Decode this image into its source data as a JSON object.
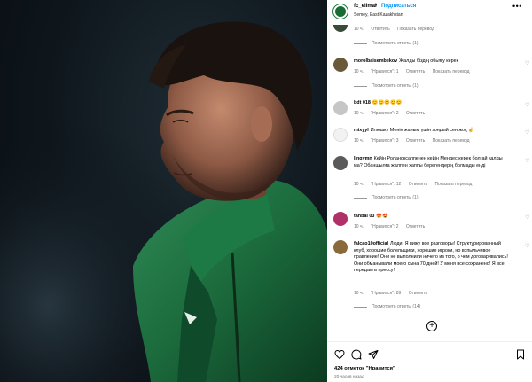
{
  "post": {
    "username": "fc_elimai",
    "separator": "•",
    "follow_label": "Подписаться",
    "location": "Semey, East Kazakhstan",
    "more_label": "•••"
  },
  "comments": [
    {
      "user": "",
      "text": "",
      "time": "10 ч.",
      "reply": "Ответить",
      "translate": "Показать перевод",
      "replies": "Посмотреть ответы (1)",
      "avatar_color": "#3a4a3a"
    },
    {
      "user": "morolbaisembekov",
      "text": "Жалды біздің обьягу керек",
      "time": "10 ч.",
      "likes": "\"Нравится\": 1",
      "reply": "Ответить",
      "translate": "Показать перевод",
      "replies": "Посмотреть ответы (1)",
      "avatar_color": "#6b5a3a"
    },
    {
      "user": "bdt 018",
      "text": "😊😊😊😊😊",
      "time": "10 ч.",
      "likes": "\"Нравится\": 2",
      "reply": "Ответить",
      "avatar_color": "#c6c6c6"
    },
    {
      "user": "mixyyl",
      "text": "Илюшку Менің жаным үшін зондый сен жоқ ☝️",
      "time": "10 ч.",
      "likes": "\"Нравится\": 3",
      "reply": "Ответить",
      "translate": "Показать перевод",
      "avatar_color": "#f2f2f2"
    },
    {
      "user": "linqymn",
      "text": "Кейін Роланоксаппенен кейін Мендес керек болғай қалды ма? Обаншылға жалпен хаппы берегендерің болмады енді",
      "time": "10 ч.",
      "likes": "\"Нравится\": 12",
      "reply": "Ответить",
      "translate": "Показать перевод",
      "replies": "Посмотреть ответы (1)",
      "avatar_color": "#5a5a5a"
    },
    {
      "user": "tanbai 03",
      "text": "😍😍",
      "time": "10 ч.",
      "likes": "\"Нравится\": 2",
      "reply": "Ответить",
      "avatar_color": "#b0306a"
    },
    {
      "user": "falcao10official",
      "text": "Люди! Я вижу все разговоры! Структурированный клуб, хорошие болельщики, хорошие игроки, но вспыльчивое правление! Они не выполнили ничего из того, о чем договаривались! Они обманывали моего сына 70 дней! У меня все сохранено! Я все передам в прессу!",
      "time": "10 ч.",
      "likes": "\"Нравится\": 89",
      "reply": "Ответить",
      "replies": "Посмотреть ответы (14)",
      "avatar_color": "#8a6a3a"
    }
  ],
  "actions": {
    "like_icon": "heart-icon",
    "comment_icon": "comment-icon",
    "share_icon": "send-icon",
    "save_icon": "bookmark-icon",
    "add_icon": "plus-circle-icon",
    "add_symbol": "+"
  },
  "likes_count": "424",
  "likes_label": "отметок \"Нравится\"",
  "time_ago": "20 часов назад"
}
